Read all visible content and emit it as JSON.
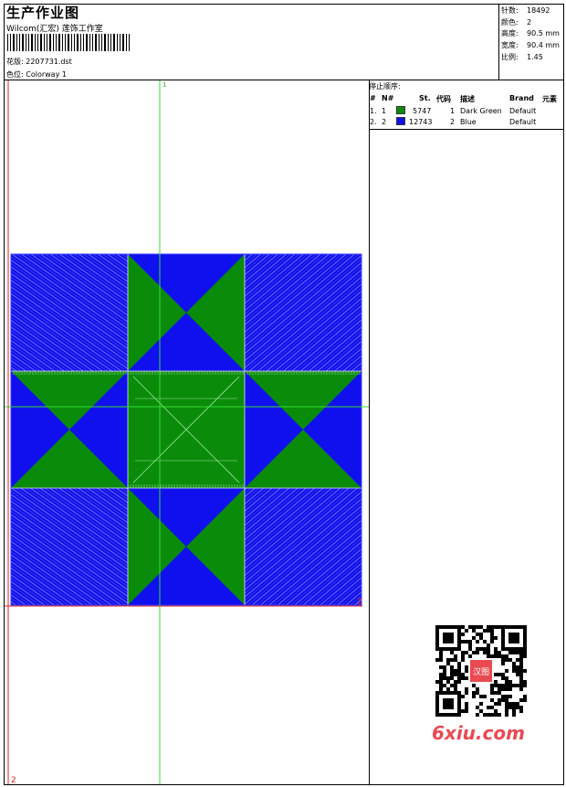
{
  "header": {
    "title": "生产作业图",
    "studio": "Wilcom(汇宏) 莲饰工作室",
    "design_label": "花版:",
    "design_file": "2207731.dst",
    "color_label": "色位:",
    "colorway": "Colorway 1"
  },
  "stats": [
    {
      "label": "针数:",
      "value": "18492"
    },
    {
      "label": "颜色:",
      "value": "2"
    },
    {
      "label": "高度:",
      "value": "90.5 mm"
    },
    {
      "label": "宽度:",
      "value": "90.4 mm"
    },
    {
      "label": "比例:",
      "value": "1.45"
    }
  ],
  "stop_sequence": {
    "title": "停止顺序:",
    "columns": [
      "#",
      "N#",
      "St.",
      "代码",
      "描述",
      "Brand",
      "元素"
    ],
    "rows": [
      {
        "index": "1.",
        "n": "1",
        "color": "#0a8c0a",
        "stitches": "5747",
        "code": "1",
        "description": "Dark Green",
        "brand": "Default"
      },
      {
        "index": "2.",
        "n": "2",
        "color": "#1010ee",
        "stitches": "12743",
        "code": "2",
        "description": "Blue",
        "brand": "Default"
      }
    ]
  },
  "canvas": {
    "marker_top": "1",
    "marker_right": "2",
    "marker_bottom": "2",
    "colors": {
      "green": "#0a8c0a",
      "blue": "#1010ee",
      "guide_green": "#33dd33",
      "guide_red": "#dd2222"
    }
  },
  "watermark": {
    "text": "6xiu.com",
    "stamp": "汉图",
    "color": "#e94a52"
  }
}
